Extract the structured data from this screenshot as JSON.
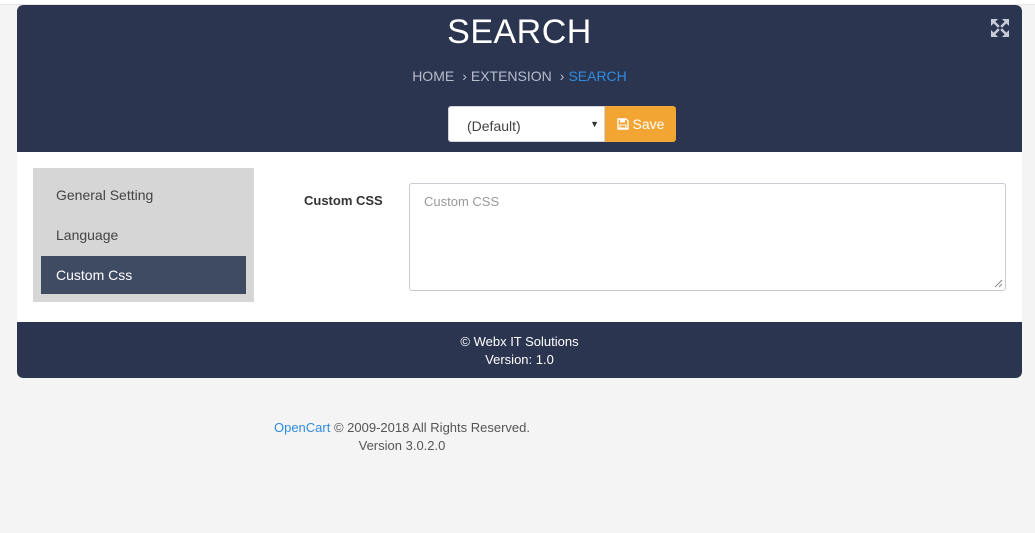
{
  "header": {
    "title": "SEARCH",
    "breadcrumb": [
      "HOME",
      "EXTENSION",
      "SEARCH"
    ],
    "separator": "›",
    "store_select": "(Default)",
    "save_label": "Save",
    "expand_icon": "expand-arrows-icon"
  },
  "sidebar": {
    "items": [
      {
        "label": "General Setting",
        "active": false
      },
      {
        "label": "Language",
        "active": false
      },
      {
        "label": "Custom Css",
        "active": true
      }
    ]
  },
  "form": {
    "custom_css_label": "Custom CSS",
    "custom_css_placeholder": "Custom CSS",
    "custom_css_value": ""
  },
  "footer": {
    "copyright": "© Webx IT Solutions",
    "version": "Version: 1.0"
  },
  "page_footer": {
    "opencart_link": "OpenCart",
    "rights": "© 2009-2018 All Rights Reserved.",
    "version": "Version 3.0.2.0"
  },
  "colors": {
    "header_bg": "#2b3550",
    "accent": "#f3a533",
    "active_link": "#2f8ce0",
    "active_menu": "#3f4a63"
  }
}
